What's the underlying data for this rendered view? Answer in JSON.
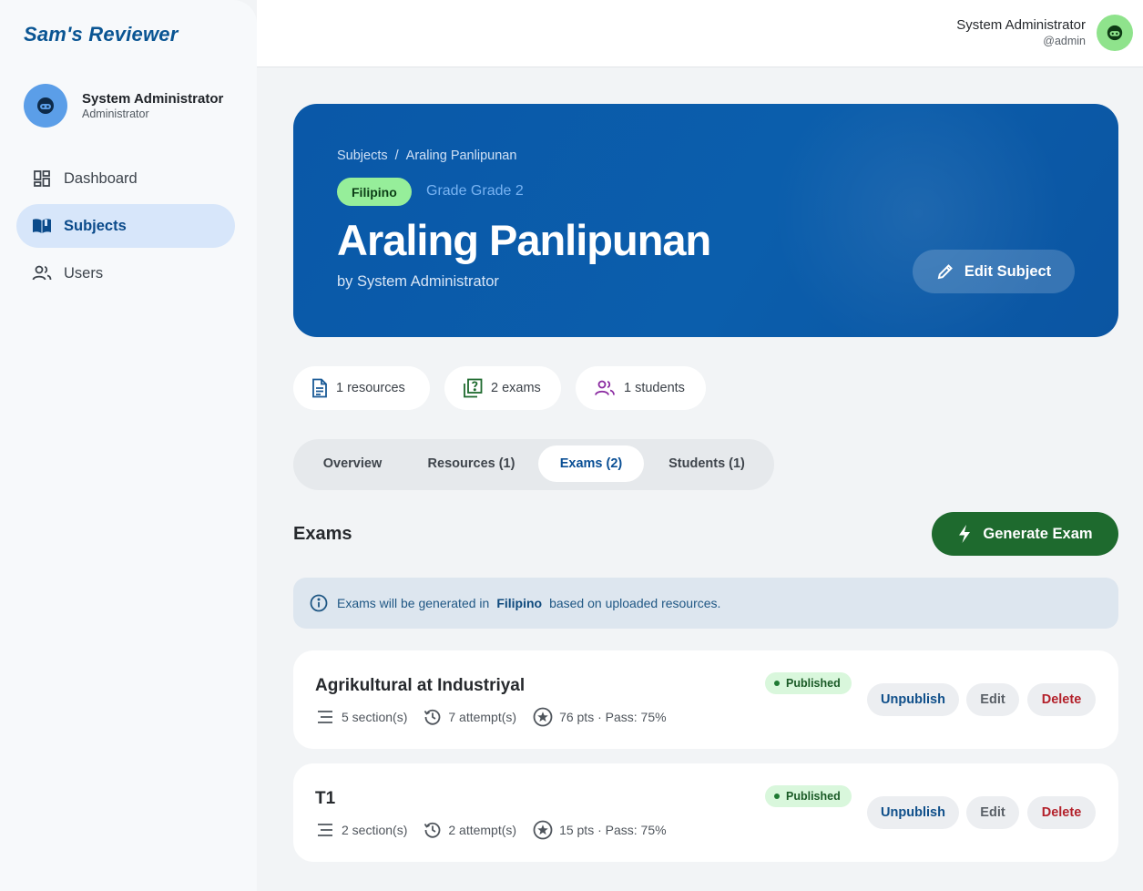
{
  "app": {
    "brand": "Sam's Reviewer"
  },
  "sidebar": {
    "profile": {
      "name": "System Administrator",
      "role": "Administrator"
    },
    "items": [
      {
        "label": "Dashboard",
        "icon": "dashboard-icon"
      },
      {
        "label": "Subjects",
        "icon": "book-icon",
        "active": true
      },
      {
        "label": "Users",
        "icon": "users-icon"
      }
    ]
  },
  "topbar": {
    "user_name": "System Administrator",
    "user_handle": "@admin"
  },
  "hero": {
    "breadcrumb": [
      "Subjects",
      "Araling Panlipunan"
    ],
    "breadcrumb_sep": "/",
    "language": "Filipino",
    "grade": "Grade Grade 2",
    "title": "Araling Panlipunan",
    "author": "by System Administrator",
    "edit_label": "Edit Subject"
  },
  "stats": {
    "resources": "1 resources",
    "exams": "2 exams",
    "students": "1 students"
  },
  "tabs": [
    {
      "label": "Overview"
    },
    {
      "label": "Resources (1)"
    },
    {
      "label": "Exams (2)",
      "active": true
    },
    {
      "label": "Students (1)"
    }
  ],
  "exams_section": {
    "title": "Exams",
    "generate_label": "Generate Exam",
    "info_prefix": "Exams will be generated in",
    "info_language": "Filipino",
    "info_suffix": "based on uploaded resources."
  },
  "exams": [
    {
      "title": "Agrikultural at Industriyal",
      "sections": "5 section(s)",
      "attempts": "7 attempt(s)",
      "points": "76 pts · Pass: 75%",
      "status": "Published",
      "unpublish_label": "Unpublish",
      "edit_label": "Edit",
      "delete_label": "Delete"
    },
    {
      "title": "T1",
      "sections": "2 section(s)",
      "attempts": "2 attempt(s)",
      "points": "15 pts · Pass: 75%",
      "status": "Published",
      "unpublish_label": "Unpublish",
      "edit_label": "Edit",
      "delete_label": "Delete"
    }
  ],
  "colors": {
    "brand": "#0a5593",
    "hero": "#0b5eac",
    "language_chip": "#96ee9a",
    "generate_button": "#1e6a2e",
    "published_badge": "#d9f7dc",
    "delete": "#b3212b"
  }
}
